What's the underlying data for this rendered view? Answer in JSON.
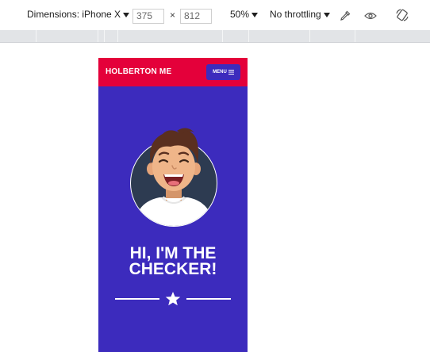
{
  "devtools": {
    "dimensions_label": "Dimensions: iPhone X",
    "width_value": "375",
    "times_symbol": "×",
    "height_value": "812",
    "zoom_label": "50%",
    "throttling_label": "No throttling",
    "icons": [
      "eyedropper-icon",
      "eye-icon",
      "rotate-icon"
    ]
  },
  "page": {
    "brand": "HOLBERTON ME",
    "menu_label": "MENU",
    "hero_line1": "HI, I'M THE",
    "hero_line2": "CHECKER!",
    "colors": {
      "nav": "#e4003a",
      "background": "#3c2bbd",
      "text": "#ffffff"
    }
  }
}
